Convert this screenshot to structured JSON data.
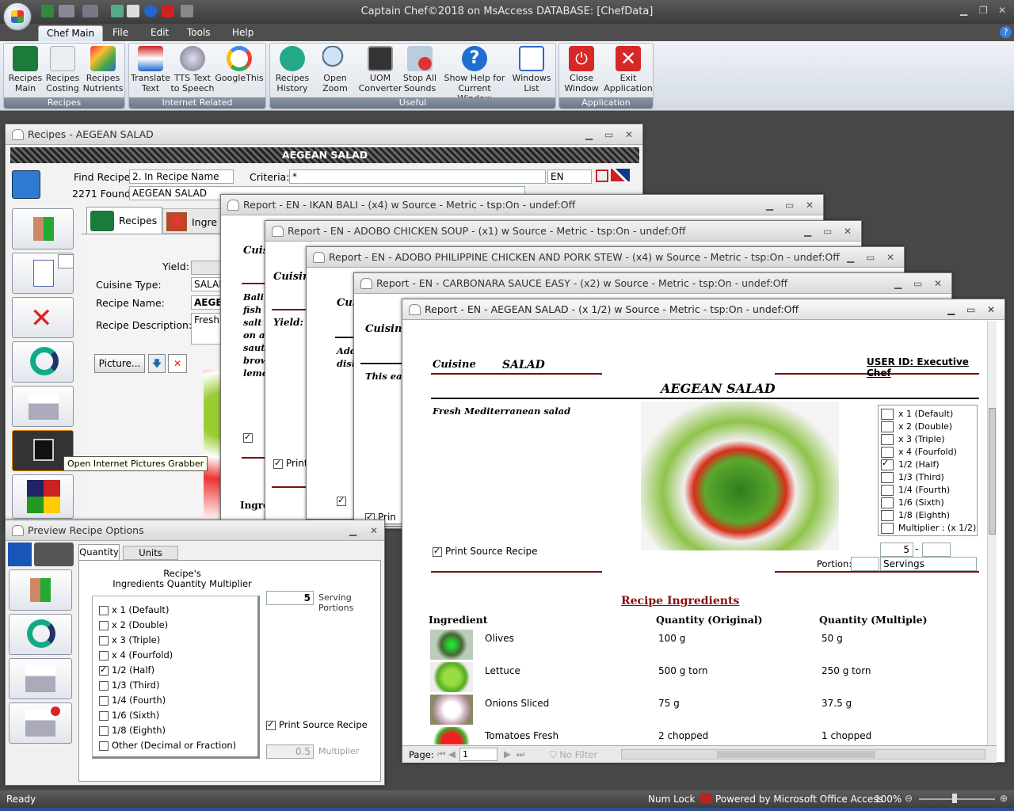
{
  "app": {
    "title": "Captain Chef©2018 on MsAccess DATABASE: [ChefData]",
    "tabs": [
      "Chef Main",
      "File",
      "Edit",
      "Tools",
      "Help"
    ]
  },
  "ribbon": {
    "groups": [
      {
        "label": "Recipes",
        "buttons": [
          [
            "Recipes",
            "Main"
          ],
          [
            "Recipes",
            "Costing"
          ],
          [
            "Recipes",
            "Nutrients"
          ]
        ]
      },
      {
        "label": "Internet Related",
        "buttons": [
          [
            "Translate",
            "Text"
          ],
          [
            "TTS Text",
            "to Speech"
          ],
          [
            "GoogleThis",
            ""
          ]
        ]
      },
      {
        "label": "Useful",
        "buttons": [
          [
            "Recipes",
            "History"
          ],
          [
            "Open",
            "Zoom"
          ],
          [
            "UOM",
            "Converter"
          ],
          [
            "Stop All",
            "Sounds"
          ],
          [
            "Show Help for",
            "Current Window"
          ],
          [
            "Windows",
            "List"
          ]
        ]
      },
      {
        "label": "Application",
        "buttons": [
          [
            "Close",
            "Window"
          ],
          [
            "Exit",
            "Application"
          ]
        ]
      }
    ]
  },
  "recipes_window": {
    "title": "Recipes - AEGEAN SALAD",
    "banner": "AEGEAN SALAD",
    "find_label": "Find Recipe:",
    "find_value": "2. In Recipe Name",
    "criteria_label": "Criteria:",
    "criteria_value": "*",
    "lang": "EN",
    "found_label": "2271 Found",
    "found_value": "AEGEAN SALAD",
    "tab_recipes": "Recipes",
    "tab_ingredients": "Ingre",
    "yield_label": "Yield:",
    "cuisine_label": "Cuisine Type:",
    "cuisine_value": "SALAD",
    "name_label": "Recipe Name:",
    "name_value": "AEGEA",
    "desc_label": "Recipe Description:",
    "desc_value": "Fresh",
    "picture_btn": "Picture...",
    "tooltip": "Open Internet Pictures Grabber"
  },
  "reports": [
    {
      "title": "Report - EN - IKAN BALI - (x4) w Source - Metric - tsp:On - undef:Off",
      "snippet_head": "Cuis",
      "snippet": [
        "Bali",
        "fish",
        "salt",
        "on a",
        "saut",
        "brow",
        "lemo"
      ],
      "foot": "Ingre"
    },
    {
      "title": "Report - EN - ADOBO CHICKEN SOUP - (x1) w Source - Metric - tsp:On - undef:Off",
      "snippet_head": "Cuisine",
      "snippet": [
        "Yield:"
      ],
      "foot": "Print"
    },
    {
      "title": "Report - EN - ADOBO PHILIPPINE CHICKEN AND PORK STEW - (x4) w Source - Metric - tsp:On - undef:Off",
      "snippet_head": "Cui",
      "snippet": [
        "Add",
        "disl"
      ],
      "foot": ""
    },
    {
      "title": "Report - EN - CARBONARA SAUCE EASY - (x2) w Source - Metric - tsp:On - undef:Off",
      "snippet_head": "Cuisine",
      "snippet": [
        "This ea"
      ],
      "foot": "Prin"
    }
  ],
  "main_report": {
    "title": "Report - EN - AEGEAN SALAD - (x 1/2) w Source - Metric - tsp:On - undef:Off",
    "cuisine_label": "Cuisine",
    "cuisine_value": "SALAD",
    "user_id": "USER ID: Executive Chef",
    "recipe_title": "AEGEAN SALAD",
    "description": "Fresh Mediterranean salad",
    "multipliers": [
      {
        "label": "x 1 (Default)",
        "checked": false
      },
      {
        "label": "x 2 (Double)",
        "checked": false
      },
      {
        "label": "x 3 (Triple)",
        "checked": false
      },
      {
        "label": "x 4 (Fourfold)",
        "checked": false
      },
      {
        "label": "1/2 (Half)",
        "checked": true
      },
      {
        "label": "1/3 (Third)",
        "checked": false
      },
      {
        "label": "1/4 (Fourth)",
        "checked": false
      },
      {
        "label": "1/6 (Sixth)",
        "checked": false
      },
      {
        "label": "1/8 (Eighth)",
        "checked": false
      },
      {
        "label": "Multiplier  : (x 1/2)",
        "checked": false
      }
    ],
    "servings_count": "5",
    "servings_dash": "-",
    "portion_label": "Portion:",
    "servings_label": "Servings",
    "print_source": "Print Source Recipe",
    "ingredients_heading": "Recipe Ingredients",
    "col_ingredient": "Ingredient",
    "col_original": "Quantity (Original)",
    "col_multiple": "Quantity (Multiple)",
    "ingredients": [
      {
        "name": "Olives",
        "original": "100 g",
        "multiple": "50 g"
      },
      {
        "name": "Lettuce",
        "original": "500 g torn",
        "multiple": "250 g torn"
      },
      {
        "name": "Onions Sliced",
        "original": "75 g",
        "multiple": "37.5 g"
      },
      {
        "name": "Tomatoes Fresh",
        "original": "2 chopped",
        "multiple": "1 chopped"
      }
    ],
    "page_label": "Page:",
    "page_value": "1",
    "no_filter": "No Filter"
  },
  "preview_window": {
    "title": "Preview Recipe Options",
    "tab_quantity": "Quantity",
    "tab_units": "Units System",
    "heading_line1": "Recipe's",
    "heading_line2": "Ingredients Quantity Multiplier",
    "options": [
      {
        "label": "x 1 (Default)",
        "checked": false
      },
      {
        "label": "x 2 (Double)",
        "checked": false
      },
      {
        "label": "x 3 (Triple)",
        "checked": false
      },
      {
        "label": "x 4 (Fourfold)",
        "checked": false
      },
      {
        "label": "1/2 (Half)",
        "checked": true
      },
      {
        "label": "1/3 (Third)",
        "checked": false
      },
      {
        "label": "1/4 (Fourth)",
        "checked": false
      },
      {
        "label": "1/6 (Sixth)",
        "checked": false
      },
      {
        "label": "1/8 (Eighth)",
        "checked": false
      },
      {
        "label": "Other (Decimal or Fraction)",
        "checked": false
      }
    ],
    "servings_value": "5",
    "serving_label1": "Serving",
    "serving_label2": "Portions",
    "print_source": "Print Source Recipe",
    "multiplier_value": "0.5",
    "multiplier_label": "Multiplier"
  },
  "statusbar": {
    "ready": "Ready",
    "numlock": "Num Lock",
    "powered": "Powered by Microsoft Office Access",
    "zoom": "100%"
  }
}
